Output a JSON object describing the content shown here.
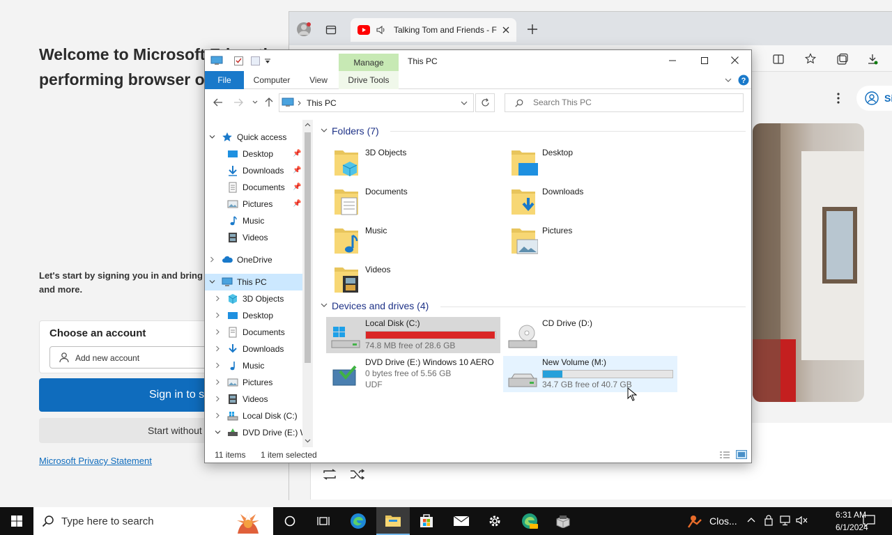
{
  "setup_page": {
    "heading": "Welcome to Microsoft Edge, the\nperforming browser on",
    "subtext": "Let's start by signing you in and bring\nand more.",
    "choose_account": "Choose an account",
    "add_account": "Add new account",
    "sign_in": "Sign in to sync",
    "start_without": "Start without your data",
    "privacy": "Microsoft Privacy Statement"
  },
  "browser": {
    "tab_title": "Talking Tom and Friends - F",
    "profile_letter": "Si"
  },
  "explorer": {
    "title": "This PC",
    "ribbon": {
      "manage": "Manage",
      "file": "File",
      "computer": "Computer",
      "view": "View",
      "drive_tools": "Drive Tools"
    },
    "address": "This PC",
    "search_placeholder": "Search This PC",
    "nav": [
      {
        "label": "Quick access"
      },
      {
        "label": "Desktop"
      },
      {
        "label": "Downloads"
      },
      {
        "label": "Documents"
      },
      {
        "label": "Pictures"
      },
      {
        "label": "Music"
      },
      {
        "label": "Videos"
      },
      {
        "label": "OneDrive"
      },
      {
        "label": "This PC"
      },
      {
        "label": "3D Objects"
      },
      {
        "label": "Desktop"
      },
      {
        "label": "Documents"
      },
      {
        "label": "Downloads"
      },
      {
        "label": "Music"
      },
      {
        "label": "Pictures"
      },
      {
        "label": "Videos"
      },
      {
        "label": "Local Disk (C:)"
      },
      {
        "label": "DVD Drive (E:) W"
      }
    ],
    "folders_header": "Folders (7)",
    "folders": [
      {
        "name": "3D Objects",
        "icon": "3d-objects-icon"
      },
      {
        "name": "Desktop",
        "icon": "desktop-folder-icon"
      },
      {
        "name": "Documents",
        "icon": "documents-folder-icon"
      },
      {
        "name": "Downloads",
        "icon": "downloads-folder-icon"
      },
      {
        "name": "Music",
        "icon": "music-folder-icon"
      },
      {
        "name": "Pictures",
        "icon": "pictures-folder-icon"
      },
      {
        "name": "Videos",
        "icon": "videos-folder-icon"
      }
    ],
    "drives_header": "Devices and drives (4)",
    "drives": [
      {
        "name": "Local Disk (C:)",
        "info": "74.8 MB free of 28.6 GB",
        "used_fraction": 0.997,
        "bar_color": "#da2626"
      },
      {
        "name": "CD Drive (D:)"
      },
      {
        "name": "DVD Drive (E:) Windows 10 AERO",
        "info": "0 bytes free of 5.56 GB",
        "fs": "UDF"
      },
      {
        "name": "New Volume (M:)",
        "info": "34.7 GB free of 40.7 GB",
        "used_fraction": 0.15,
        "bar_color": "#26a0da"
      }
    ],
    "status_items": "11 items",
    "status_selected": "1 item selected"
  },
  "taskbar": {
    "search_placeholder": "Type here to search",
    "tray_text": "Clos...",
    "time": "6:31 AM",
    "date": "6/1/2024"
  }
}
